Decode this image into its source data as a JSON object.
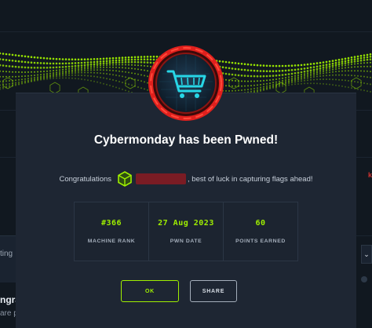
{
  "modal": {
    "title": "Cybermonday has been Pwned!",
    "congrats_prefix": "Congratulations",
    "congrats_suffix": ", best of luck in capturing flags ahead!",
    "stats": [
      {
        "value": "#366",
        "label": "MACHINE RANK"
      },
      {
        "value": "27 Aug 2023",
        "label": "PWN DATE"
      },
      {
        "value": "60",
        "label": "POINTS EARNED"
      }
    ],
    "ok_label": "OK",
    "share_label": "SHARE"
  },
  "background": {
    "left_text": "ting",
    "left_heading": "ngra",
    "left_sub": "are p",
    "right_badge": "k"
  },
  "icons": {
    "machine_logo": "shopping-cart-icon",
    "user_rank": "green-cube-icon",
    "select_caret": "chevron-down-icon"
  },
  "colors": {
    "accent_green": "#9fef00",
    "logo_ring": "#e0201d",
    "logo_glow": "#27d6e6",
    "modal_bg": "#1e2633",
    "page_bg": "#141b24"
  }
}
